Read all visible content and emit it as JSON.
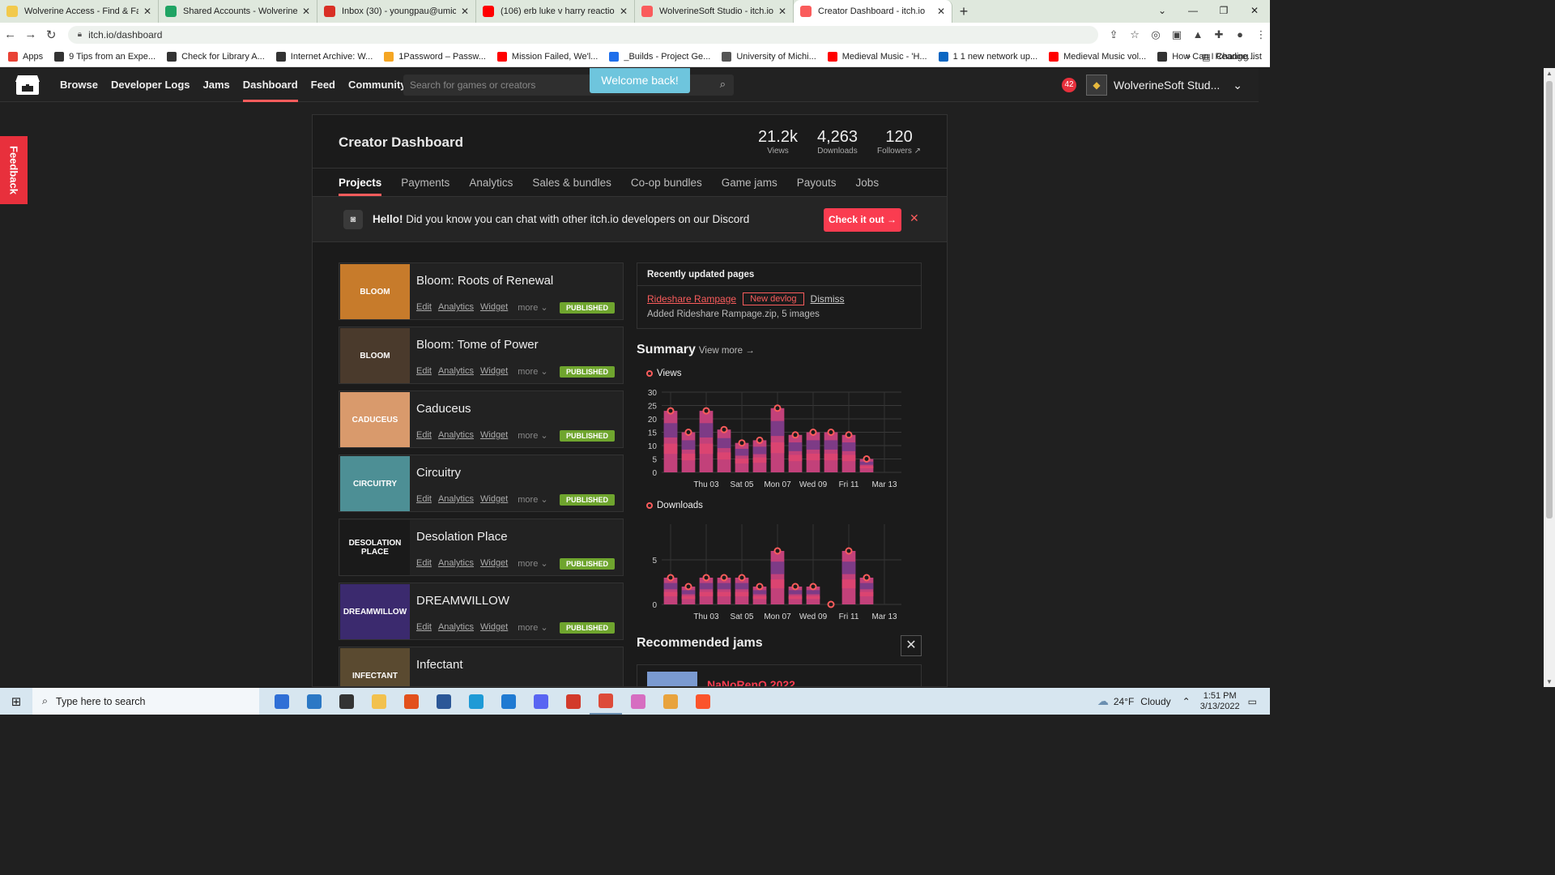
{
  "browser": {
    "tabs": [
      {
        "label": "Wolverine Access - Find & Favori",
        "icon": "umich-icon",
        "color": "#f2c94c"
      },
      {
        "label": "Shared Accounts - WolverineSoft",
        "icon": "drive-icon",
        "color": "#1fa463"
      },
      {
        "label": "Inbox (30) - youngpau@umich.ec",
        "icon": "gmail-icon",
        "color": "#d93025"
      },
      {
        "label": "(106) erb luke v harry reaction - Y",
        "icon": "youtube-icon",
        "color": "#ff0000"
      },
      {
        "label": "WolverineSoft Studio - itch.io",
        "icon": "itch-icon",
        "color": "#fa5c5c"
      },
      {
        "label": "Creator Dashboard - itch.io",
        "icon": "itch-icon",
        "color": "#fa5c5c"
      }
    ],
    "url": "itch.io/dashboard",
    "bookmarks": [
      {
        "label": "Apps",
        "color": "#e94235"
      },
      {
        "label": "9 Tips from an Expe...",
        "color": "#333333"
      },
      {
        "label": "Check for Library A...",
        "color": "#333333"
      },
      {
        "label": "Internet Archive: W...",
        "color": "#333333"
      },
      {
        "label": "1Password – Passw...",
        "color": "#f5a623"
      },
      {
        "label": "Mission Failed, We'l...",
        "color": "#ff0000"
      },
      {
        "label": "_Builds - Project Ge...",
        "color": "#1f6feb"
      },
      {
        "label": "University of Michi...",
        "color": "#555555"
      },
      {
        "label": "Medieval Music - 'H...",
        "color": "#ff0000"
      },
      {
        "label": "1 1 new network up...",
        "color": "#0a66c2"
      },
      {
        "label": "Medieval Music vol...",
        "color": "#ff0000"
      },
      {
        "label": "How Can I Change...",
        "color": "#333333"
      }
    ],
    "reading_list": "Reading list"
  },
  "itch": {
    "nav": [
      "Browse",
      "Developer Logs",
      "Jams",
      "Dashboard",
      "Feed",
      "Community"
    ],
    "active_nav": "Dashboard",
    "search_placeholder": "Search for games or creators",
    "welcome": "Welcome back!",
    "notifications": "42",
    "username": "WolverineSoft Stud...",
    "feedback": "Feedback"
  },
  "dashboard": {
    "title": "Creator Dashboard",
    "stats": [
      {
        "value": "21.2k",
        "label": "Views"
      },
      {
        "value": "4,263",
        "label": "Downloads"
      },
      {
        "value": "120",
        "label": "Followers ↗"
      }
    ],
    "tabs": [
      "Projects",
      "Payments",
      "Analytics",
      "Sales & bundles",
      "Co-op bundles",
      "Game jams",
      "Payouts",
      "Jobs"
    ],
    "discord": {
      "hello": "Hello!",
      "message": " Did you know you can chat with other itch.io developers on our Discord",
      "button": "Check it out →",
      "close": "✕"
    },
    "projects": [
      {
        "title": "Bloom: Roots of Renewal",
        "thumb": "BLOOM",
        "bg": "#c77b2b",
        "status": "PUBLISHED"
      },
      {
        "title": "Bloom: Tome of Power",
        "thumb": "BLOOM",
        "bg": "#4a3a2c",
        "status": "PUBLISHED"
      },
      {
        "title": "Caduceus",
        "thumb": "CADUCEUS",
        "bg": "#d99a6c",
        "status": "PUBLISHED"
      },
      {
        "title": "Circuitry",
        "thumb": "CIRCUITRY",
        "bg": "#4d8f95",
        "status": "PUBLISHED"
      },
      {
        "title": "Desolation Place",
        "thumb": "DESOLATION PLACE",
        "bg": "#1a1a1a",
        "status": "PUBLISHED"
      },
      {
        "title": "DREAMWILLOW",
        "thumb": "DREAMWILLOW",
        "bg": "#3b2a6e",
        "status": "PUBLISHED"
      },
      {
        "title": "Infectant",
        "thumb": "INFECTANT",
        "bg": "#5a4a30",
        "status": ""
      }
    ],
    "project_links": {
      "edit": "Edit",
      "analytics": "Analytics",
      "widget": "Widget",
      "more": "more ⌄"
    },
    "recent": {
      "header": "Recently updated pages",
      "link": "Rideshare Rampage",
      "tag": "New devlog",
      "dismiss": "Dismiss",
      "desc": "Added Rideshare Rampage.zip, 5 images"
    },
    "summary": {
      "title": "Summary",
      "view_more": "View more →"
    },
    "recommended": {
      "title": "Recommended jams",
      "close": "✕",
      "jam": "NaNoRenO 2022"
    }
  },
  "chart_data": [
    {
      "type": "bar",
      "title": "Views",
      "categories": [
        "Mar 01",
        "Mar 02",
        "Thu 03",
        "Mar 04",
        "Sat 05",
        "Mar 06",
        "Mon 07",
        "Mar 08",
        "Wed 09",
        "Mar 10",
        "Fri 11",
        "Mar 12",
        "Mar 13"
      ],
      "tick_labels": [
        "Thu 03",
        "Sat 05",
        "Mon 07",
        "Wed 09",
        "Fri 11",
        "Mar 13"
      ],
      "values": [
        23,
        15,
        23,
        16,
        11,
        12,
        24,
        14,
        15,
        15,
        14,
        5
      ],
      "yticks": [
        0,
        5,
        10,
        15,
        20,
        25,
        30
      ],
      "ylim": [
        0,
        30
      ]
    },
    {
      "type": "bar",
      "title": "Downloads",
      "categories": [
        "Mar 01",
        "Mar 02",
        "Thu 03",
        "Mar 04",
        "Sat 05",
        "Mar 06",
        "Mon 07",
        "Mar 08",
        "Wed 09",
        "Mar 10",
        "Fri 11",
        "Mar 12",
        "Mar 13"
      ],
      "tick_labels": [
        "Thu 03",
        "Sat 05",
        "Mon 07",
        "Wed 09",
        "Fri 11",
        "Mar 13"
      ],
      "values": [
        3,
        2,
        3,
        3,
        3,
        2,
        6,
        2,
        2,
        0,
        6,
        3
      ],
      "yticks": [
        0,
        5
      ],
      "ylim": [
        0,
        9
      ]
    }
  ],
  "taskbar": {
    "search": "Type here to search",
    "temp": "24°F",
    "weather": "Cloudy",
    "time": "1:51 PM",
    "date": "3/13/2022",
    "apps": [
      {
        "name": "store-icon",
        "color": "#2f6fd6"
      },
      {
        "name": "mail-icon",
        "color": "#2b78c5"
      },
      {
        "name": "obs-icon",
        "color": "#333333"
      },
      {
        "name": "explorer-icon",
        "color": "#f2c14e"
      },
      {
        "name": "office-icon",
        "color": "#e2501c"
      },
      {
        "name": "word-icon",
        "color": "#2b5797"
      },
      {
        "name": "edge-icon",
        "color": "#1e9ad6"
      },
      {
        "name": "vscode-icon",
        "color": "#1f7ad2"
      },
      {
        "name": "discord-icon",
        "color": "#5865f2"
      },
      {
        "name": "app-icon",
        "color": "#d23a2b"
      },
      {
        "name": "chrome-icon",
        "color": "#dd4b39"
      },
      {
        "name": "itunes-icon",
        "color": "#d66ec1"
      },
      {
        "name": "chrome-alt-icon",
        "color": "#e8a33d"
      },
      {
        "name": "brave-icon",
        "color": "#fb542b"
      }
    ]
  }
}
